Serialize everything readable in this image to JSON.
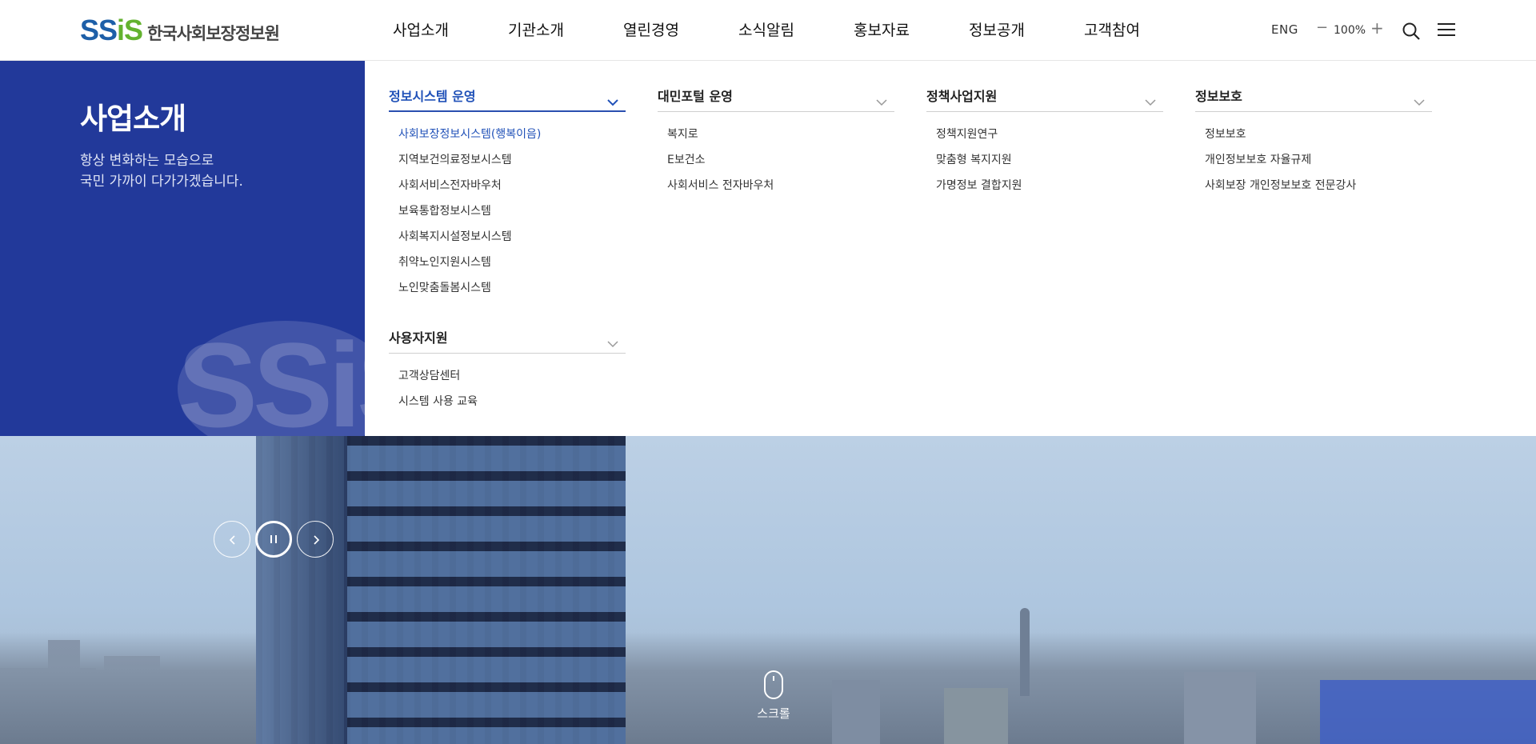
{
  "header": {
    "logo_text": "한국사회보장정보원",
    "nav": [
      "사업소개",
      "기관소개",
      "열린경영",
      "소식알림",
      "홍보자료",
      "정보공개",
      "고객참여"
    ],
    "lang": "ENG",
    "zoom": "100%"
  },
  "mega": {
    "title": "사업소개",
    "desc_line1": "항상 변화하는 모습으로",
    "desc_line2": "국민 가까이 다가가겠습니다.",
    "columns": [
      {
        "title": "정보시스템 운영",
        "items": [
          "사회보장정보시스템(행복이음)",
          "지역보건의료정보시스템",
          "사회서비스전자바우처",
          "보육통합정보시스템",
          "사회복지시설정보시스템",
          "취약노인지원시스템",
          "노인맞춤돌봄시스템"
        ]
      },
      {
        "title": "대민포털 운영",
        "items": [
          "복지로",
          "E보건소",
          "사회서비스 전자바우처"
        ]
      },
      {
        "title": "정책사업지원",
        "items": [
          "정책지원연구",
          "맞춤형 복지지원",
          "가명정보 결합지원"
        ]
      },
      {
        "title": "정보보호",
        "items": [
          "정보보호",
          "개인정보보호 자율규제",
          "사회보장 개인정보보호 전문강사"
        ]
      },
      {
        "title": "사용자지원",
        "items": [
          "고객상담센터",
          "시스템 사용 교육"
        ]
      }
    ]
  },
  "hero": {
    "scroll_label": "스크롤"
  }
}
